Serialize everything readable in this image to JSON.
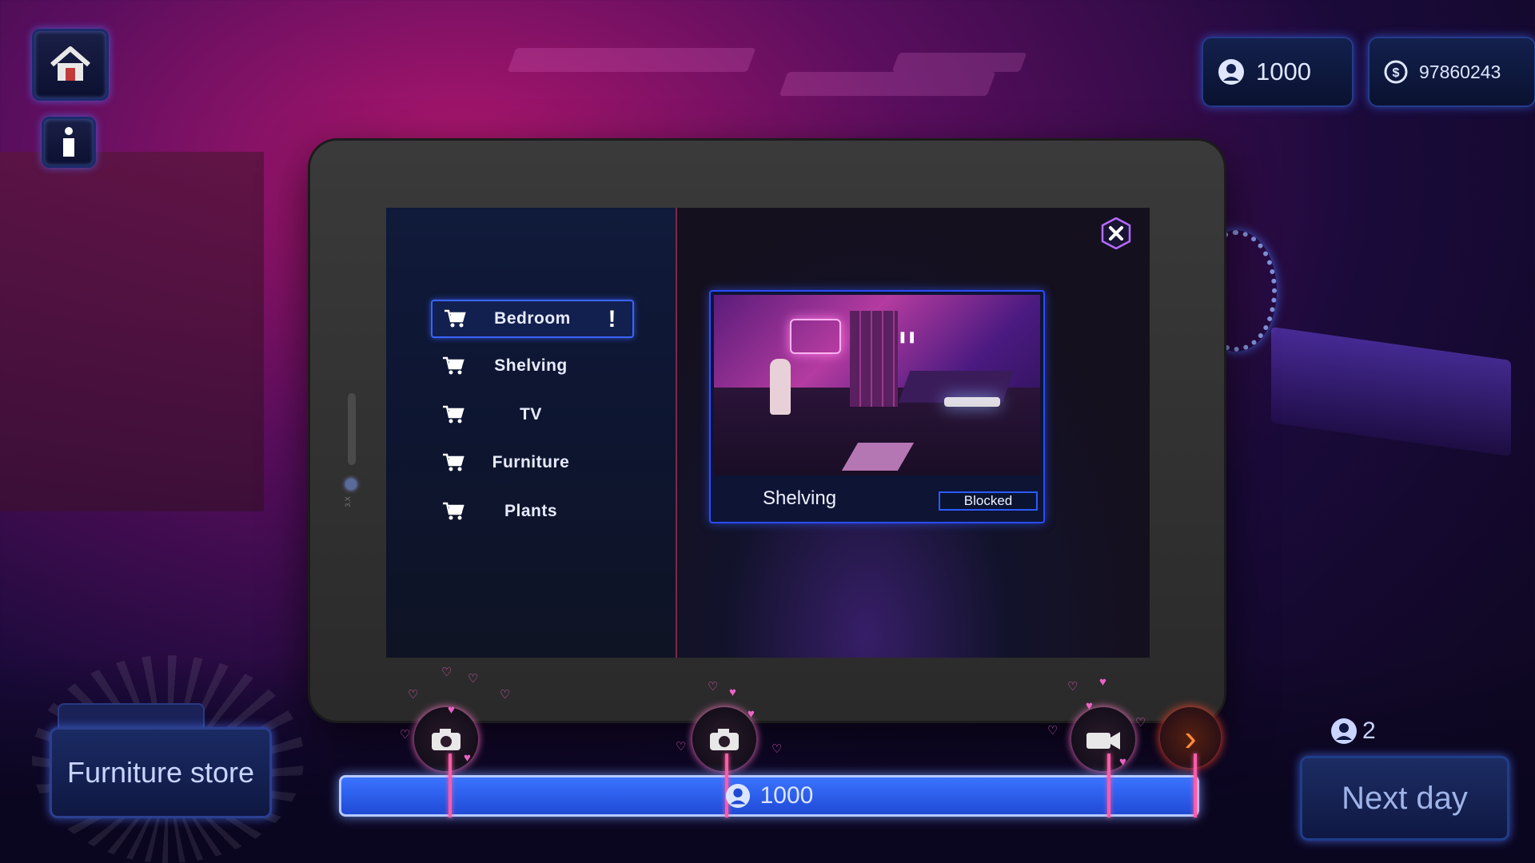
{
  "hud": {
    "currency_a": "1000",
    "currency_b": "97860243"
  },
  "menu": {
    "items": [
      {
        "label": "Bedroom",
        "active": true,
        "alert": "!"
      },
      {
        "label": "Shelving",
        "active": false
      },
      {
        "label": "TV",
        "active": false
      },
      {
        "label": "Furniture",
        "active": false
      },
      {
        "label": "Plants",
        "active": false
      }
    ]
  },
  "preview": {
    "title": "Shelving",
    "status": "Blocked"
  },
  "progress": {
    "value": "1000"
  },
  "buttons": {
    "store": "Furniture store",
    "next_day": "Next day",
    "next_arrow": "›"
  },
  "players": {
    "count": "2"
  },
  "tablet": {
    "side_label": "3.X"
  },
  "colors": {
    "accent_blue": "#2b5bff",
    "neon_pink": "#ff5ca8",
    "bar_fill": "#1f4ad6"
  },
  "icons": {
    "home": "home-icon",
    "info": "info-icon",
    "user": "user-icon",
    "coin": "coin-icon",
    "cart": "cart-icon",
    "close": "close-icon",
    "camera": "camera-icon",
    "photo": "photo-camera-icon",
    "video": "video-camera-icon",
    "arrow": "chevron-right-icon"
  }
}
